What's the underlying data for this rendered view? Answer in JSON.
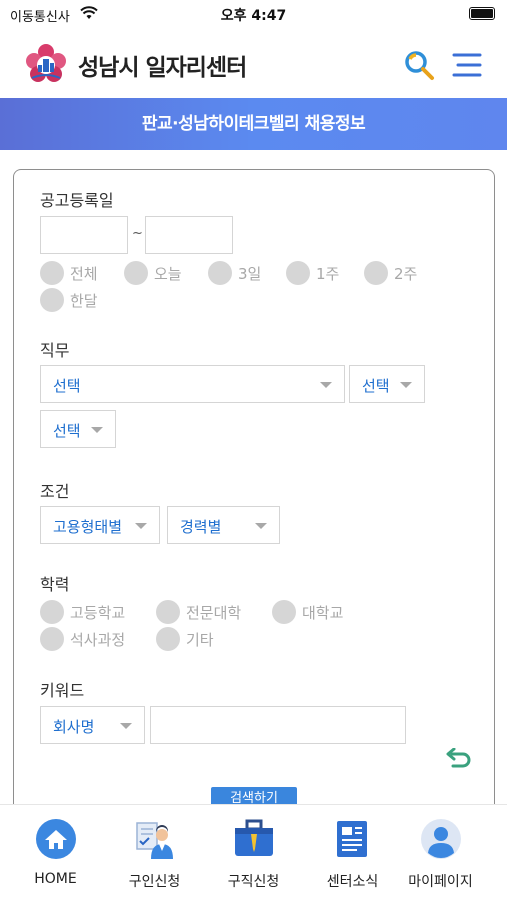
{
  "status": {
    "carrier": "이동통신사",
    "time": "오후 4:47"
  },
  "header": {
    "title": "성남시 일자리센터",
    "search_icon": "search-icon",
    "menu_icon": "hamburger-menu-icon"
  },
  "banner": {
    "title": "판교·성남하이테크벨리 채용정보"
  },
  "form": {
    "date": {
      "label": "공고등록일",
      "start_value": "",
      "end_value": "",
      "separator": "~",
      "options": [
        "전체",
        "오늘",
        "3일",
        "1주",
        "2주",
        "한달"
      ]
    },
    "job": {
      "label": "직무",
      "select1": "선택",
      "select2": "선택",
      "select3": "선택"
    },
    "condition": {
      "label": "조건",
      "employment_type": "고용형태별",
      "career": "경력별"
    },
    "education": {
      "label": "학력",
      "options": [
        "고등학교",
        "전문대학",
        "대학교",
        "석사과정",
        "기타"
      ]
    },
    "keyword": {
      "label": "키워드",
      "field_select": "회사명",
      "value": ""
    },
    "search_button": "검색하기"
  },
  "tabs": [
    {
      "label": "HOME",
      "icon": "home-icon"
    },
    {
      "label": "구인신청",
      "icon": "recruiter-icon"
    },
    {
      "label": "구직신청",
      "icon": "briefcase-icon"
    },
    {
      "label": "센터소식",
      "icon": "news-icon"
    },
    {
      "label": "마이페이지",
      "icon": "user-icon"
    }
  ],
  "colors": {
    "accent": "#1f6fcf",
    "banner_start": "#5a6fd6",
    "banner_end": "#5f86ee",
    "reset": "#3aa17e"
  }
}
